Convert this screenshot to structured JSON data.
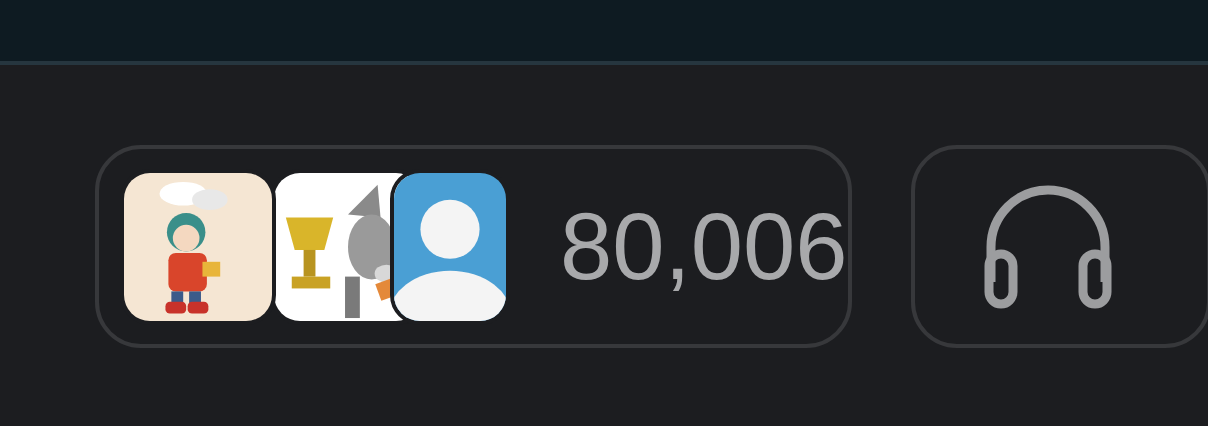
{
  "members_button": {
    "avatars": [
      {
        "kind": "picture"
      },
      {
        "kind": "picture"
      },
      {
        "kind": "silhouette"
      }
    ],
    "count": "80,006"
  }
}
